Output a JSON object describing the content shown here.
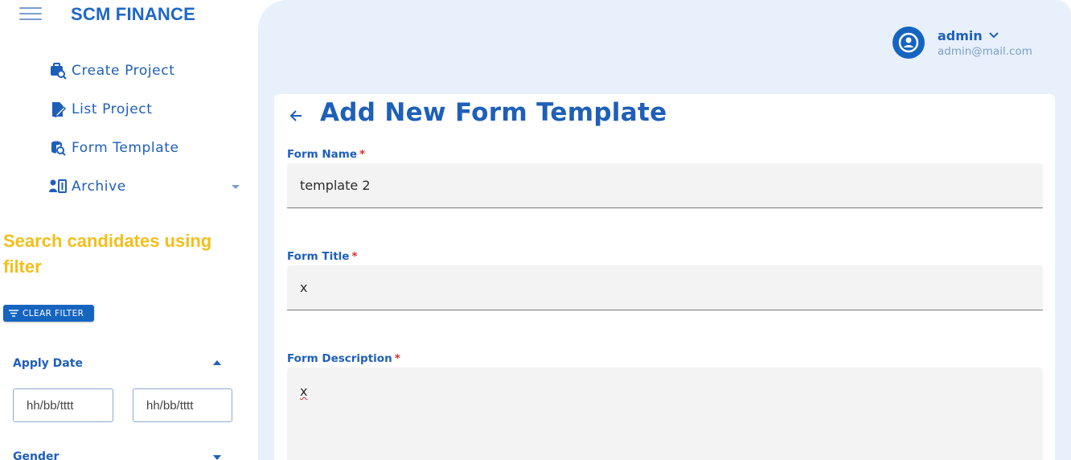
{
  "app": {
    "brand": "SCM FINANCE"
  },
  "sidebar": {
    "items": [
      {
        "label": "Create Project",
        "icon": "briefcase-search-icon"
      },
      {
        "label": "List Project",
        "icon": "file-edit-icon"
      },
      {
        "label": "Form Template",
        "icon": "database-search-icon"
      },
      {
        "label": "Archive",
        "icon": "archive-person-icon"
      }
    ],
    "filter_heading": "Search candidates using filter",
    "clear_filter_label": "CLEAR FILTER",
    "apply_date": {
      "title": "Apply Date",
      "from_placeholder": "hh/bb/tttt",
      "to_placeholder": "hh/bb/tttt"
    },
    "gender": {
      "title": "Gender"
    }
  },
  "header": {
    "user_name": "admin",
    "user_email": "admin@mail.com"
  },
  "form": {
    "title": "Add New Form Template",
    "required_mark": "*",
    "name": {
      "label": "Form Name",
      "value": "template 2"
    },
    "form_title": {
      "label": "Form Title",
      "value": "x"
    },
    "description": {
      "label": "Form Description",
      "value": "x"
    }
  },
  "colors": {
    "primary": "#1565c0",
    "accent_text": "#1e5fb8",
    "filter_heading": "#f2bf1b",
    "required": "#d32f2f",
    "main_background": "#e8f0fb"
  }
}
